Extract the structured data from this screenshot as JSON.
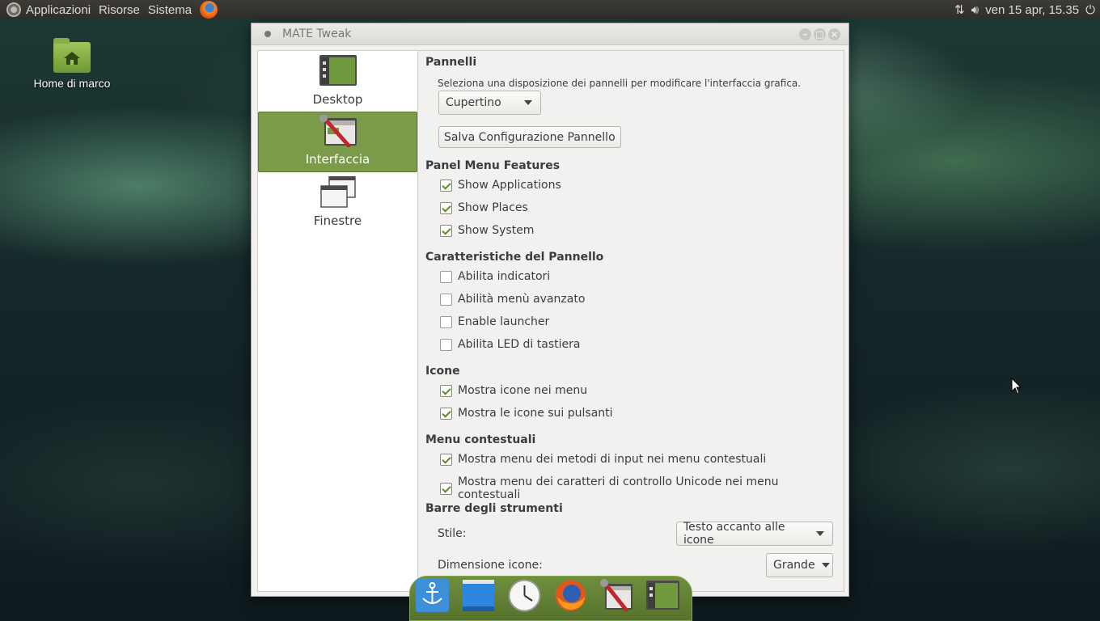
{
  "top_panel": {
    "menus": [
      "Applicazioni",
      "Risorse",
      "Sistema"
    ],
    "datetime": "ven 15 apr, 15.35"
  },
  "desktop": {
    "home_icon_label": "Home di marco"
  },
  "window": {
    "title": "MATE Tweak",
    "sidebar": [
      {
        "label": "Desktop",
        "active": false
      },
      {
        "label": "Interfaccia",
        "active": true
      },
      {
        "label": "Finestre",
        "active": false
      }
    ],
    "panels": {
      "title": "Pannelli",
      "description": "Seleziona una disposizione dei pannelli per modificare l'interfaccia grafica.",
      "layout_value": "Cupertino",
      "save_button": "Salva Configurazione Pannello"
    },
    "panel_menu_features": {
      "title": "Panel Menu Features",
      "options": [
        {
          "label": "Show Applications",
          "checked": true
        },
        {
          "label": "Show Places",
          "checked": true
        },
        {
          "label": "Show System",
          "checked": true
        }
      ]
    },
    "panel_features": {
      "title": "Caratteristiche del Pannello",
      "options": [
        {
          "label": "Abilita indicatori",
          "checked": false
        },
        {
          "label": "Abilità menù avanzato",
          "checked": false
        },
        {
          "label": "Enable launcher",
          "checked": false
        },
        {
          "label": "Abilita LED di tastiera",
          "checked": false
        }
      ]
    },
    "icons": {
      "title": "Icone",
      "options": [
        {
          "label": "Mostra icone nei menu",
          "checked": true
        },
        {
          "label": "Mostra le icone sui pulsanti",
          "checked": true
        }
      ]
    },
    "context_menus": {
      "title": "Menu contestuali",
      "options": [
        {
          "label": "Mostra menu dei metodi di input nei menu contestuali",
          "checked": true
        },
        {
          "label": "Mostra menu dei caratteri di controllo Unicode nei menu contestuali",
          "checked": true
        }
      ]
    },
    "toolbars": {
      "title": "Barre degli strumenti",
      "style_label": "Stile:",
      "style_value": "Testo accanto alle icone",
      "icon_size_label": "Dimensione icone:",
      "icon_size_value": "Grande"
    }
  },
  "dock": {
    "items": [
      "anchor-icon",
      "window-icon",
      "clock-icon",
      "firefox-icon",
      "mate-tweak-icon",
      "desktop-settings-icon"
    ]
  },
  "colors": {
    "accent": "#7b9a4a",
    "check": "#5f8a2c"
  }
}
